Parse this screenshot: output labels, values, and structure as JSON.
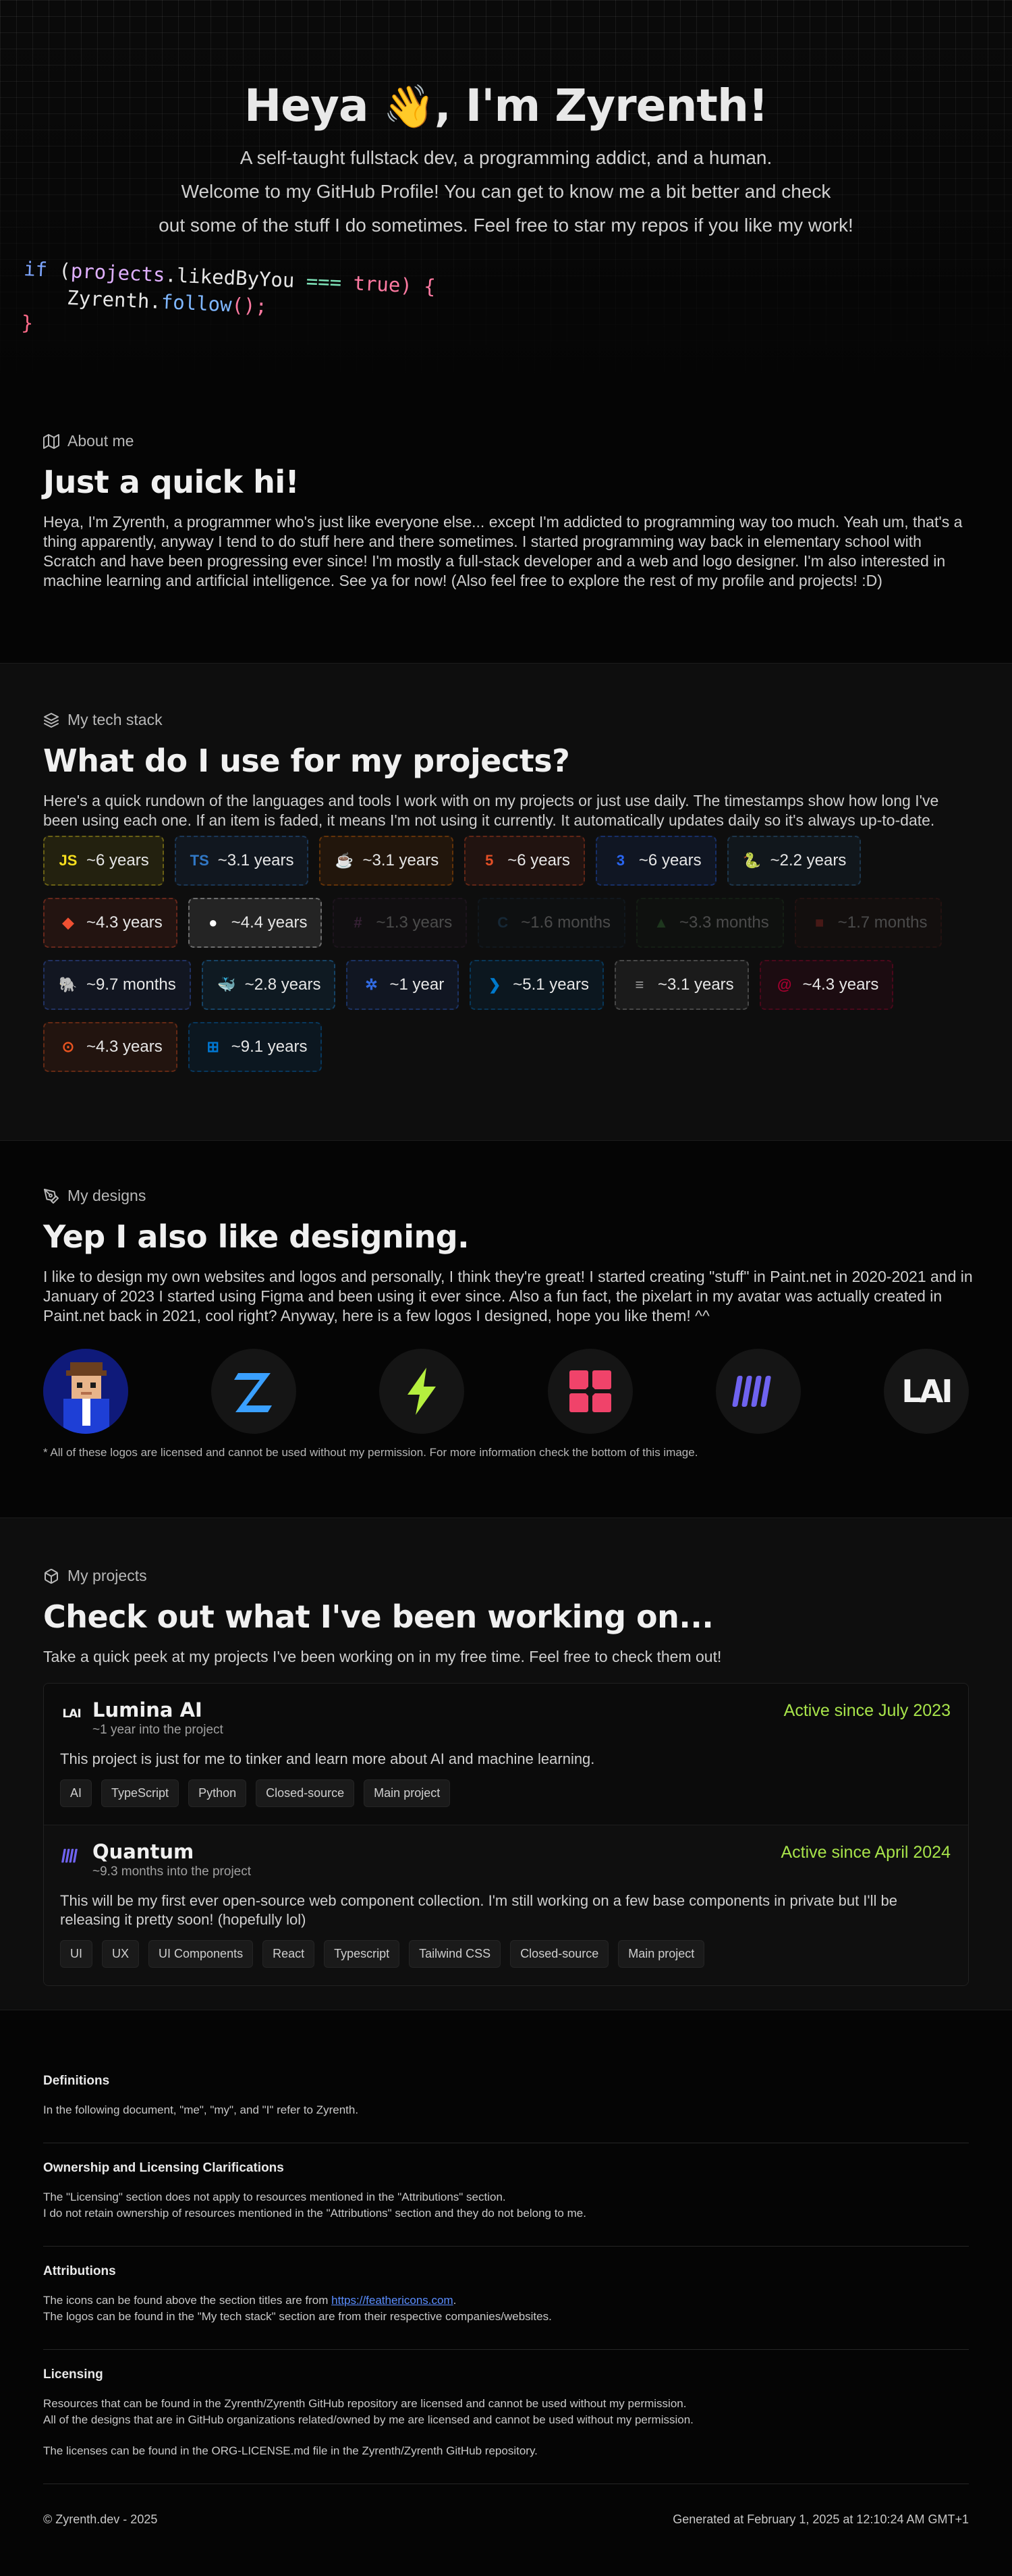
{
  "hero": {
    "title_pre": "Heya ",
    "title_emoji": "👋",
    "title_post": ", I'm Zyrenth!",
    "line1": "A self-taught fullstack dev, a programming addict, and a human.",
    "line2": "Welcome to my GitHub Profile! You can get to know me a bit better and check",
    "line3": "out some of the stuff I do sometimes. Feel free to star my repos if you like my work!",
    "code": {
      "kw_if": "if",
      "open": " (",
      "obj": "projects",
      "dot1": ".",
      "prop": "likedByYou",
      "op": " === ",
      "bool": "true",
      "close": ") {",
      "name": "Zyrenth",
      "dot2": ".",
      "fn": "follow",
      "call": "();",
      "end": "}"
    }
  },
  "about": {
    "label": "About me",
    "heading": "Just a quick hi!",
    "text": "Heya, I'm Zyrenth, a programmer who's just like everyone else... except I'm addicted to programming way too much. Yeah um, that's a thing apparently, anyway I tend to do stuff here and there sometimes. I started programming way back in elementary school with Scratch and have been progressing ever since! I'm mostly a full-stack developer and a web and logo designer. I'm also interested in machine learning and artificial intelligence. See ya for now! (Also feel free to explore the rest of my profile and projects! :D)"
  },
  "stack": {
    "label": "My tech stack",
    "heading": "What do I use for my projects?",
    "text": "Here's a quick rundown of the languages and tools I work with on my projects or just use daily. The timestamps show how long I've been using each one. If an item is faded, it means I'm not using it currently. It automatically updates daily so it's always up-to-date.",
    "rows": [
      [
        {
          "icon": "javascript-icon",
          "glyph": "JS",
          "years": "~6 years",
          "color": "#f7df1e",
          "faded": false
        },
        {
          "icon": "typescript-icon",
          "glyph": "TS",
          "years": "~3.1 years",
          "color": "#3178c6",
          "faded": false
        },
        {
          "icon": "java-icon",
          "glyph": "☕",
          "years": "~3.1 years",
          "color": "#e76f00",
          "faded": false
        },
        {
          "icon": "html5-icon",
          "glyph": "5",
          "years": "~6 years",
          "color": "#e34f26",
          "faded": false
        },
        {
          "icon": "css3-icon",
          "glyph": "3",
          "years": "~6 years",
          "color": "#2965f1",
          "faded": false
        },
        {
          "icon": "python-icon",
          "glyph": "🐍",
          "years": "~2.2 years",
          "color": "#3776ab",
          "faded": false
        }
      ],
      [
        {
          "icon": "git-icon",
          "glyph": "◆",
          "years": "~4.3 years",
          "color": "#f05032",
          "faded": false
        },
        {
          "icon": "github-icon",
          "glyph": "●",
          "years": "~4.4 years",
          "color": "#ffffff",
          "faded": false
        },
        {
          "icon": "csharp-icon",
          "glyph": "#",
          "years": "~1.3 years",
          "color": "#9b4f96",
          "faded": true
        },
        {
          "icon": "c-icon",
          "glyph": "C",
          "years": "~1.6 months",
          "color": "#2d6c9f",
          "faded": true
        },
        {
          "icon": "mongodb-icon",
          "glyph": "▲",
          "years": "~3.3 months",
          "color": "#47a248",
          "faded": true
        },
        {
          "icon": "redis-icon",
          "glyph": "■",
          "years": "~1.7 months",
          "color": "#dc382d",
          "faded": true
        }
      ],
      [
        {
          "icon": "postgresql-icon",
          "glyph": "🐘",
          "years": "~9.7 months",
          "color": "#4169e1",
          "faded": false
        },
        {
          "icon": "docker-icon",
          "glyph": "🐳",
          "years": "~2.8 years",
          "color": "#2496ed",
          "faded": false
        },
        {
          "icon": "kubernetes-icon",
          "glyph": "✲",
          "years": "~1 year",
          "color": "#326ce5",
          "faded": false
        },
        {
          "icon": "vscode-icon",
          "glyph": "❯",
          "years": "~5.1 years",
          "color": "#007acc",
          "faded": false
        },
        {
          "icon": "terminal-icon",
          "glyph": "≡",
          "years": "~3.1 years",
          "color": "#9e9e9e",
          "faded": false
        },
        {
          "icon": "debian-icon",
          "glyph": "@",
          "years": "~4.3 years",
          "color": "#a80030",
          "faded": false
        }
      ],
      [
        {
          "icon": "ubuntu-icon",
          "glyph": "⊙",
          "years": "~4.3 years",
          "color": "#e95420",
          "faded": false
        },
        {
          "icon": "windows-icon",
          "glyph": "⊞",
          "years": "~9.1 years",
          "color": "#0078d4",
          "faded": false
        }
      ]
    ]
  },
  "designs": {
    "label": "My designs",
    "heading": "Yep I also like designing.",
    "text": "I like to design my own websites and logos and personally, I think they're great! I started creating \"stuff\" in Paint.net in 2020-2021 and in January of 2023 I started using Figma and been using it ever since. Also a fun fact, the pixelart in my avatar was actually created in Paint.net back in 2021, cool right? Anyway, here is a few logos I designed, hope you like them! ^^",
    "note": "* All of these logos are licensed and cannot be used without my permission. For more information check the bottom of this image.",
    "logos": [
      "pixel-avatar-logo",
      "z-logo",
      "lightning-logo",
      "red-blocks-logo",
      "quantum-logo",
      "lumina-ai-logo"
    ],
    "lumina_text": "LAI"
  },
  "projects": {
    "label": "My projects",
    "heading": "Check out what I've been working on...",
    "text": "Take a quick peek at my projects I've been working on in my free time. Feel free to check them out!",
    "items": [
      {
        "name": "Lumina AI",
        "icon_text": "LAI",
        "sub": "~1 year into the project",
        "since": "Active since July 2023",
        "desc": "This project is just for me to tinker and learn more about AI and machine learning.",
        "tags": [
          "AI",
          "TypeScript",
          "Python",
          "Closed-source",
          "Main project"
        ]
      },
      {
        "name": "Quantum",
        "icon_text": "",
        "sub": "~9.3 months into the project",
        "since": "Active since April 2024",
        "desc": "This will be my first ever open-source web component collection. I'm still working on a few base components in private but I'll be releasing it pretty soon! (hopefully lol)",
        "tags": [
          "UI",
          "UX",
          "UI Components",
          "React",
          "Typescript",
          "Tailwind CSS",
          "Closed-source",
          "Main project"
        ]
      }
    ]
  },
  "footer": {
    "definitions_title": "Definitions",
    "definitions_text": "In the following document, \"me\", \"my\", and \"I\" refer to Zyrenth.",
    "ownership_title": "Ownership and Licensing Clarifications",
    "ownership_line1": "The \"Licensing\" section does not apply to resources mentioned in the \"Attributions\" section.",
    "ownership_line2": "I do not retain ownership of resources mentioned in the \"Attributions\" section and they do not belong to me.",
    "attributions_title": "Attributions",
    "attributions_line1_pre": "The icons can be found above the section titles are from ",
    "attributions_link": "https://feathericons.com",
    "attributions_line1_post": ".",
    "attributions_line2": "The logos can be found in the \"My tech stack\" section are from their respective companies/websites.",
    "licensing_title": "Licensing",
    "licensing_line1": "Resources that can be found in the Zyrenth/Zyrenth GitHub repository are licensed and cannot be used without my permission.",
    "licensing_line2": "All of the designs that are in GitHub organizations related/owned by me are licensed and cannot be used without my permission.",
    "licensing_line3": "The licenses can be found in the ORG-LICENSE.md file in the Zyrenth/Zyrenth GitHub repository.",
    "copyright": "© Zyrenth.dev - 2025",
    "generated": "Generated at February 1, 2025 at 12:10:24 AM GMT+1"
  }
}
